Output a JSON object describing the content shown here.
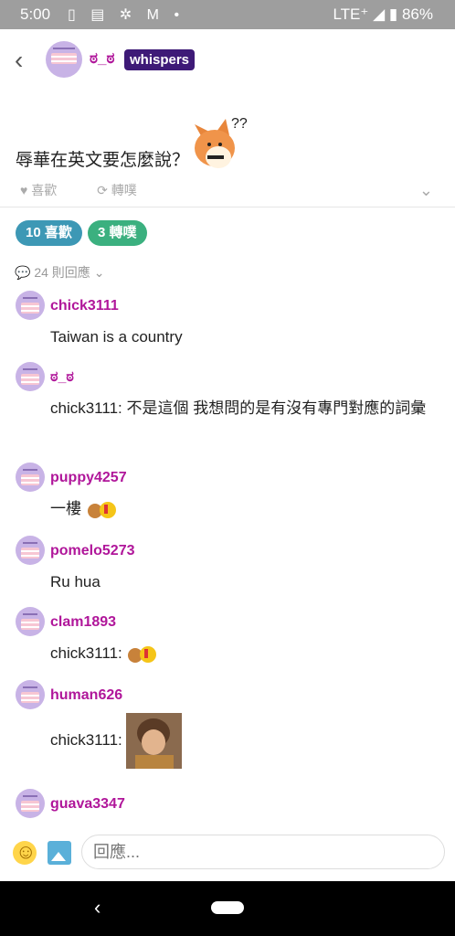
{
  "status_bar": {
    "time": "5:00",
    "network": "LTE⁺",
    "battery": "86%"
  },
  "post": {
    "author": "ಠ_ಠ",
    "badge": "whispers",
    "text": "辱華在英文要怎麼說？",
    "like_action": "喜歡",
    "reblog_action": "轉噗"
  },
  "stats": {
    "likes": "10 喜歡",
    "reblogs": "3 轉噗",
    "reply_count": "24 則回應"
  },
  "comments": [
    {
      "user": "chick3111",
      "text": "Taiwan is a country"
    },
    {
      "user": "ಠ_ಠ",
      "text": "chick3111: 不是這個 我想問的是有沒有專門對應的詞彙"
    },
    {
      "user": "puppy4257",
      "text": "一樓"
    },
    {
      "user": "pomelo5273",
      "text": "Ru hua"
    },
    {
      "user": "clam1893",
      "text": "chick3111:"
    },
    {
      "user": "human626",
      "text": "chick3111:"
    },
    {
      "user": "guava3347",
      "text": ""
    }
  ],
  "reply": {
    "placeholder": "回應..."
  },
  "icons": {
    "back": "chevron-left-icon",
    "emoji": "smiley-icon",
    "image": "image-icon"
  }
}
